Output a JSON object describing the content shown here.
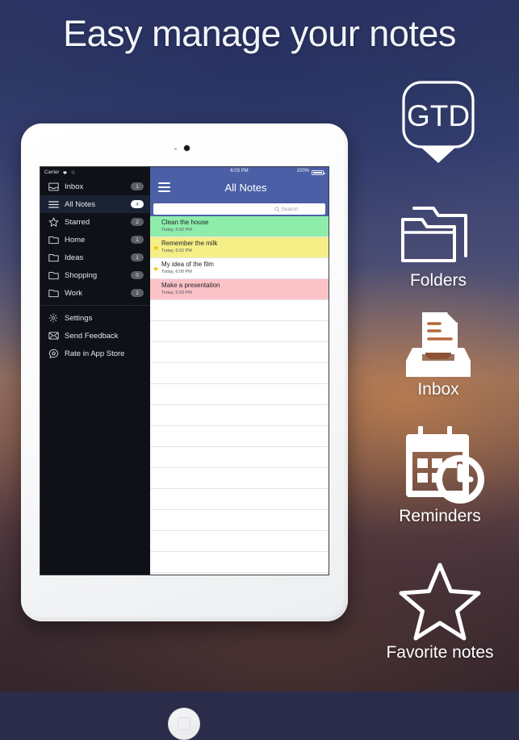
{
  "headline": "Easy manage your notes",
  "device": {
    "status_bar": {
      "carrier": "Carrier"
    },
    "navbar": {
      "time": "6:03 PM",
      "battery_text": "100%",
      "title": "All Notes",
      "menu_icon": "hamburger-icon"
    },
    "search": {
      "placeholder": "Search"
    }
  },
  "sidebar": {
    "items": [
      {
        "label": "Inbox",
        "badge": "1",
        "icon": "inbox-icon",
        "active": false
      },
      {
        "label": "All Notes",
        "badge": "4",
        "icon": "list-icon",
        "active": true
      },
      {
        "label": "Starred",
        "badge": "2",
        "icon": "star-icon",
        "active": false
      },
      {
        "label": "Home",
        "badge": "1",
        "icon": "folder-icon",
        "active": false
      },
      {
        "label": "Ideas",
        "badge": "1",
        "icon": "folder-icon",
        "active": false
      },
      {
        "label": "Shopping",
        "badge": "0",
        "icon": "folder-icon",
        "active": false
      },
      {
        "label": "Work",
        "badge": "1",
        "icon": "folder-icon",
        "active": false
      }
    ],
    "footer_items": [
      {
        "label": "Settings",
        "icon": "gear-icon"
      },
      {
        "label": "Send Feedback",
        "icon": "envelope-icon"
      },
      {
        "label": "Rate in App Store",
        "icon": "star-badge-icon"
      }
    ]
  },
  "notes": [
    {
      "title": "Clean the house",
      "subtitle": "Today, 6:02 PM",
      "color": "#8fedab",
      "starred": false
    },
    {
      "title": "Remember the milk",
      "subtitle": "Today, 6:02 PM",
      "color": "#f6ee86",
      "starred": true
    },
    {
      "title": "My idea of the film",
      "subtitle": "Today, 6:00 PM",
      "color": "#ffffff",
      "starred": true
    },
    {
      "title": "Make a presentation",
      "subtitle": "Today, 5:59 PM",
      "color": "#fbc2c8",
      "starred": false
    }
  ],
  "features": [
    {
      "id": "gtd",
      "label": "GTD",
      "icon": "gtd-pin-icon"
    },
    {
      "id": "folders",
      "label": "Folders",
      "icon": "folders-icon"
    },
    {
      "id": "inbox",
      "label": "Inbox",
      "icon": "inbox-tray-icon"
    },
    {
      "id": "reminders",
      "label": "Reminders",
      "icon": "calendar-clock-icon"
    },
    {
      "id": "favorites",
      "label": "Favorite notes",
      "icon": "star-outline-icon"
    }
  ],
  "colors": {
    "navbar": "#4a5fa5",
    "sidebar": "#0f1117",
    "sidebar_active": "#1a2233",
    "star": "#f2c200"
  }
}
